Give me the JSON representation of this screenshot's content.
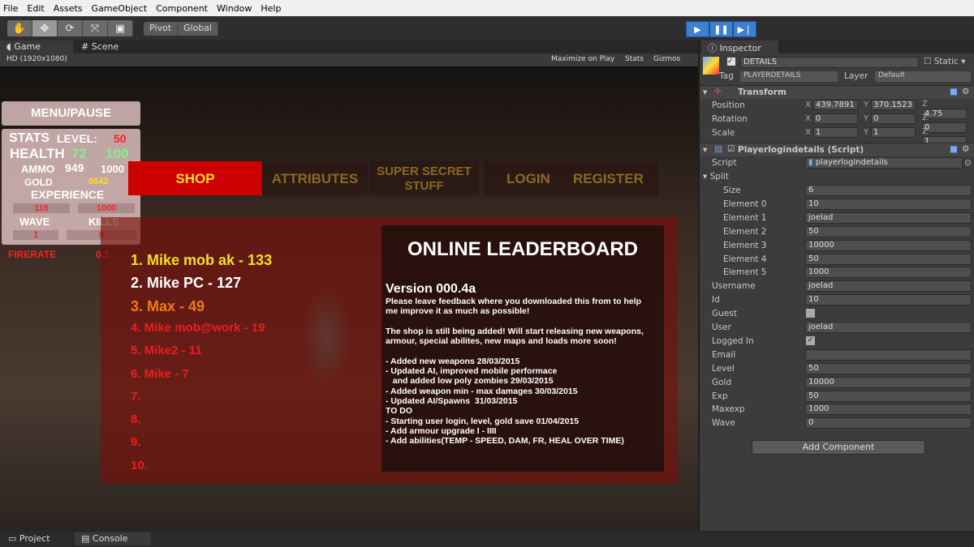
{
  "menu": [
    "File",
    "Edit",
    "Assets",
    "GameObject",
    "Component",
    "Window",
    "Help"
  ],
  "toolbar": {
    "tools": [
      "hand-icon",
      "move-icon",
      "rotate-icon",
      "scale-icon",
      "rect-icon"
    ],
    "pivot": "Pivot",
    "global": "Global"
  },
  "tabs": {
    "game": "Game",
    "scene": "Scene",
    "inspector": "Inspector",
    "project": "Project",
    "console": "Console"
  },
  "game_header": {
    "resolution": "HD (1920x1080)",
    "maximize": "Maximize on Play",
    "stats": "Stats",
    "gizmos": "Gizmos"
  },
  "hud": {
    "menu": "MENU/PAUSE",
    "stats": "STATS",
    "level_label": "LEVEL:",
    "level": "50",
    "health_label": "HEALTH",
    "health": "72",
    "health_max": "100",
    "ammo_label": "AMMO",
    "ammo": "949",
    "ammo_max": "1000",
    "gold_label": "GOLD",
    "gold": "8642",
    "exp_label": "EXPERIENCE",
    "exp": "116",
    "exp_max": "1000",
    "wave_label": "WAVE",
    "wave": "1",
    "kills_label": "KILLS",
    "kills": "6",
    "firerate_label": "FIRERATE",
    "firerate": "0.1"
  },
  "nav": [
    "SHOP",
    "ATTRIBUTES",
    "SUPER SECRET STUFF",
    "LOGIN",
    "REGISTER"
  ],
  "scores": [
    {
      "t": "1. Mike mob ak - 133",
      "c": "#f2e020"
    },
    {
      "t": "2. Mike PC - 127",
      "c": "#ffffff"
    },
    {
      "t": "3. Max - 49",
      "c": "#f07a18"
    },
    {
      "t": "4. Mike mob@work - 19",
      "c": "#e82020"
    },
    {
      "t": "5. Mike2 - 11",
      "c": "#e82020"
    },
    {
      "t": "6. Mike - 7",
      "c": "#e82020"
    },
    {
      "t": "7.",
      "c": "#e82020"
    },
    {
      "t": "8.",
      "c": "#e82020"
    },
    {
      "t": "9.",
      "c": "#e82020"
    },
    {
      "t": "10.",
      "c": "#e82020"
    }
  ],
  "leaderboard": {
    "title": "ONLINE LEADERBOARD",
    "version": "Version 000.4a",
    "lines": [
      "Please leave feedback where you downloaded this from to help",
      "me improve it as much as possible!",
      "",
      "The shop is still being added! Will start releasing new weapons,",
      "armour, special abilites, new maps and loads more soon!",
      "",
      "- Added new weapons 28/03/2015",
      "- Updated AI, improved mobile performace",
      "   and added low poly zombies 29/03/2015",
      "- Added weapon min - max damages 30/03/2015",
      "- Updated AI/Spawns  31/03/2015",
      "TO DO",
      "- Starting user login, level, gold save 01/04/2015",
      "- Add armour upgrade I - IIII",
      "- Add abilities(TEMP - SPEED, DAM, FR, HEAL OVER TIME)"
    ]
  },
  "inspector": {
    "name": "DETAILS",
    "static": "Static",
    "tag_label": "Tag",
    "tag": "PLAYERDETAILS",
    "layer_label": "Layer",
    "layer": "Default",
    "transform": "Transform",
    "position": {
      "label": "Position",
      "x": "439.7891",
      "y": "370.1523",
      "z": "4.75"
    },
    "rotation": {
      "label": "Rotation",
      "x": "0",
      "y": "0",
      "z": "0"
    },
    "scale": {
      "label": "Scale",
      "x": "1",
      "y": "1",
      "z": "1"
    },
    "script_comp": "Playerlogindetails (Script)",
    "script_label": "Script",
    "script": "playerlogindetails",
    "split": "Split",
    "fields": [
      {
        "l": "Size",
        "v": "6",
        "i": 1
      },
      {
        "l": "Element 0",
        "v": "10",
        "i": 1
      },
      {
        "l": "Element 1",
        "v": "joelad",
        "i": 1
      },
      {
        "l": "Element 2",
        "v": "50",
        "i": 1
      },
      {
        "l": "Element 3",
        "v": "10000",
        "i": 1
      },
      {
        "l": "Element 4",
        "v": "50",
        "i": 1
      },
      {
        "l": "Element 5",
        "v": "1000",
        "i": 1
      },
      {
        "l": "Username",
        "v": "joelad"
      },
      {
        "l": "Id",
        "v": "10"
      },
      {
        "l": "Guest",
        "v": "",
        "cb": false
      },
      {
        "l": "User",
        "v": "joelad"
      },
      {
        "l": "Logged In",
        "v": "",
        "cb": true
      },
      {
        "l": "Email",
        "v": ""
      },
      {
        "l": "Level",
        "v": "50"
      },
      {
        "l": "Gold",
        "v": "10000"
      },
      {
        "l": "Exp",
        "v": "50"
      },
      {
        "l": "Maxexp",
        "v": "1000"
      },
      {
        "l": "Wave",
        "v": "0"
      }
    ],
    "add_component": "Add Component"
  }
}
